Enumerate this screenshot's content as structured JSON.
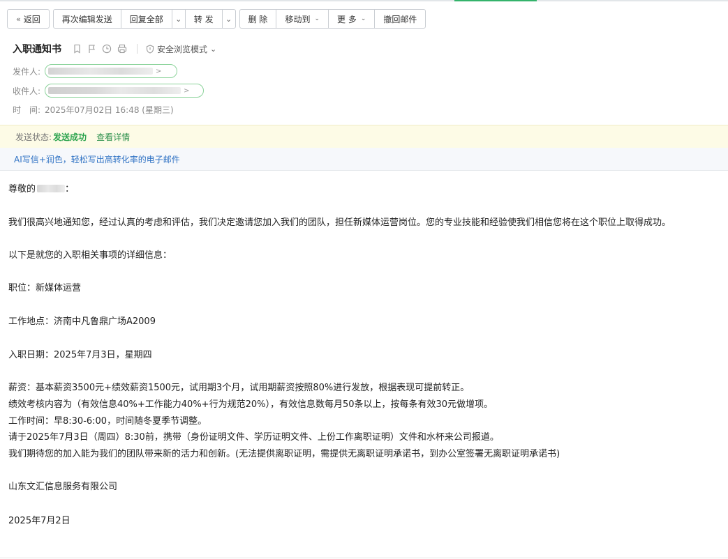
{
  "toolbar": {
    "back": "返回",
    "reedit": "再次编辑发送",
    "reply_all": "回复全部",
    "forward": "转 发",
    "delete": "删 除",
    "move_to": "移动到",
    "more": "更 多",
    "recall": "撤回邮件"
  },
  "subject": {
    "title": "入职通知书",
    "secure_mode": "安全浏览模式",
    "icons": [
      "bookmark-icon",
      "flag-icon",
      "clock-icon",
      "print-icon",
      "shield-icon"
    ]
  },
  "meta": {
    "from_label": "发件人:",
    "from_visible": "@126",
    "to_label": "收件人:",
    "time_label": "时　间:",
    "time_value": "2025年07月02日 16:48 (星期三)"
  },
  "status": {
    "label": "发送状态:",
    "value": "发送成功",
    "detail_link": "查看详情"
  },
  "ai": {
    "link": "AI写信+润色，轻松写出高转化率的电子邮件"
  },
  "body": {
    "greeting_prefix": "尊敬的",
    "greeting_suffix": "：",
    "p1": "我们很高兴地通知您，经过认真的考虑和评估，我们决定邀请您加入我们的团队，担任新媒体运营岗位。您的专业技能和经验使我们相信您将在这个职位上取得成功。",
    "p2": "以下是就您的入职相关事项的详细信息：",
    "position": "职位：新媒体运营",
    "location": "工作地点：济南中凡鲁鼎广场A2009",
    "start_date": "入职日期：2025年7月3日，星期四",
    "salary": "薪资：基本薪资3500元+绩效薪资1500元，试用期3个月，试用期薪资按照80%进行发放，根据表现可提前转正。",
    "kpi": "绩效考核内容为（有效信息40%+工作能力40%+行为规范20%），有效信息数每月50条以上，按每条有效30元做增项。",
    "hours": "工作时间：早8:30-6:00，时间随冬夏季节调整。",
    "report": "请于2025年7月3日（周四）8:30前，携带（身份证明文件、学历证明文件、上份工作离职证明）文件和水杯来公司报道。",
    "closing": "我们期待您的加入能为我们的团队带来新的活力和创新。(无法提供离职证明，需提供无离职证明承诺书，到办公室签署无离职证明承诺书)",
    "company": "山东文汇信息服务有限公司",
    "date": "2025年7月2日"
  },
  "colors": {
    "accent_green": "#34b36b",
    "status_green": "#2ea44f",
    "link_blue": "#2f72c4",
    "status_bg": "#fdfbe6"
  }
}
